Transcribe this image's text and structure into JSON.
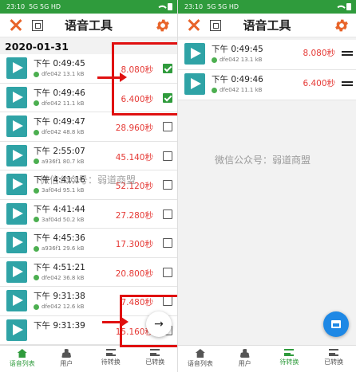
{
  "left": {
    "status_time": "23:10",
    "status_icons": "5G 5G HD",
    "title": "语音工具",
    "date": "2020-01-31",
    "rows": [
      {
        "time": "下午 0:49:45",
        "meta": "dfe042 13.1 kB",
        "dur": "8.080秒",
        "checked": true
      },
      {
        "time": "下午 0:49:46",
        "meta": "dfe042 11.1 kB",
        "dur": "6.400秒",
        "checked": true
      },
      {
        "time": "下午 0:49:47",
        "meta": "dfe042 48.8 kB",
        "dur": "28.960秒",
        "checked": false
      },
      {
        "time": "下午 2:55:07",
        "meta": "a936f1 80.7 kB",
        "dur": "45.140秒",
        "checked": false
      },
      {
        "time": "下午 4:41:16",
        "meta": "3af04d 95.1 kB",
        "dur": "52.120秒",
        "checked": false
      },
      {
        "time": "下午 4:41:44",
        "meta": "3af04d 50.2 kB",
        "dur": "27.280秒",
        "checked": false
      },
      {
        "time": "下午 4:45:36",
        "meta": "a936f1 29.6 kB",
        "dur": "17.300秒",
        "checked": false
      },
      {
        "time": "下午 4:51:21",
        "meta": "dfe042 36.8 kB",
        "dur": "20.800秒",
        "checked": false
      },
      {
        "time": "下午 9:31:38",
        "meta": "dfe042 12.6 kB",
        "dur": "7.480秒",
        "checked": false
      },
      {
        "time": "下午 9:31:39",
        "meta": "",
        "dur": "15.160秒",
        "checked": false
      }
    ],
    "nav": [
      "语音列表",
      "用户",
      "待转换",
      "已转换"
    ]
  },
  "right": {
    "status_time": "23:10",
    "status_icons": "5G 5G HD",
    "title": "语音工具",
    "rows": [
      {
        "time": "下午 0:49:45",
        "meta": "dfe042 13.1 kB",
        "dur": "8.080秒"
      },
      {
        "time": "下午 0:49:46",
        "meta": "dfe042 11.1 kB",
        "dur": "6.400秒"
      }
    ],
    "nav": [
      "语音列表",
      "用户",
      "待转换",
      "已转换"
    ]
  },
  "watermark": "微信公众号：弱道商盟",
  "fab_arrow": "→"
}
